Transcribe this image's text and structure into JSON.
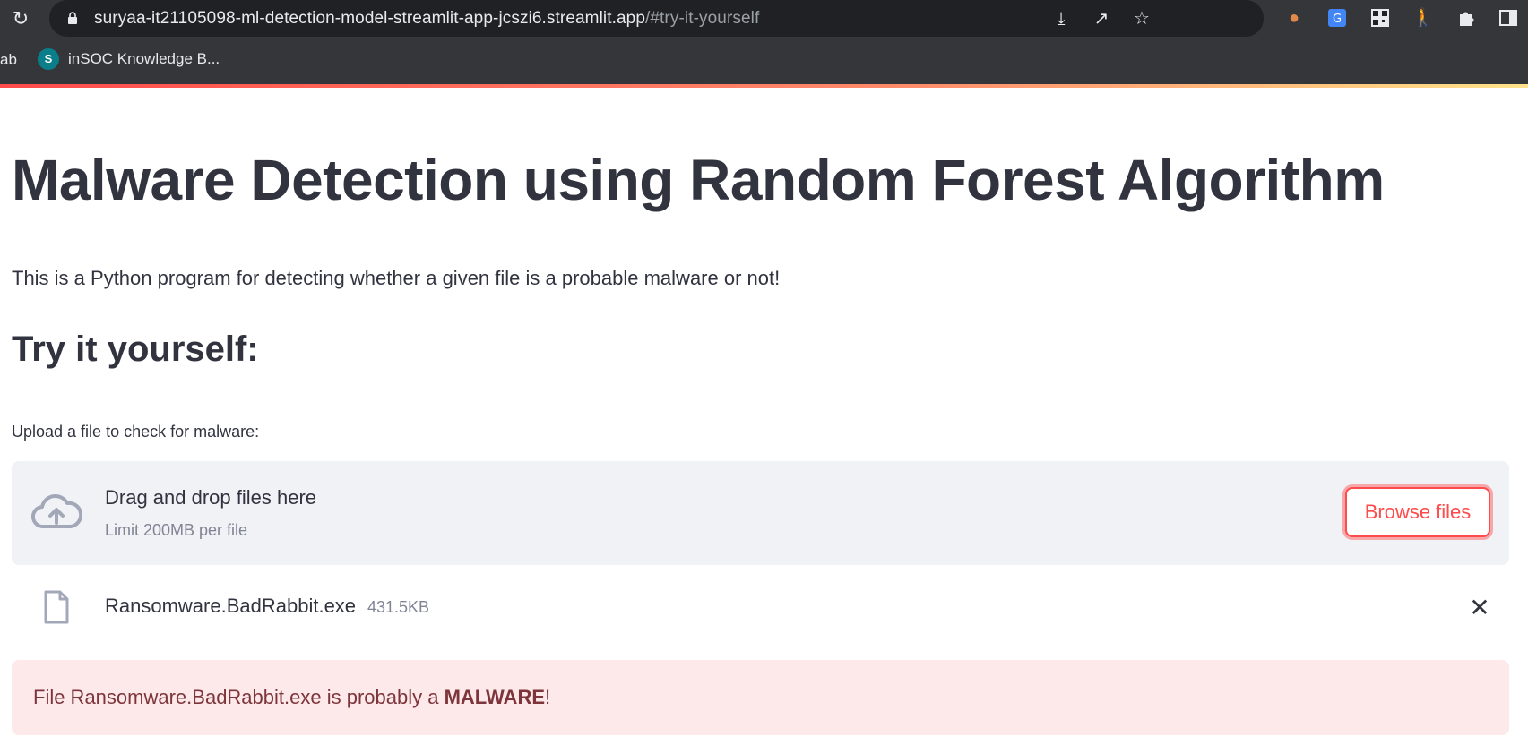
{
  "browser": {
    "url_main": "suryaa-it21105098-ml-detection-model-streamlit-app-jcszi6.streamlit.app",
    "url_hash": "/#try-it-yourself",
    "bookmarks": {
      "partial_left": "ab",
      "item_favicon": "S",
      "item_label": "inSOC Knowledge B..."
    },
    "icons": [
      "reload-icon",
      "lock-icon",
      "install-icon",
      "share-icon",
      "star-icon",
      "cookie-extension-icon",
      "translate-extension-icon",
      "qr-extension-icon",
      "person-extension-icon",
      "puzzle-icon",
      "side-panel-icon"
    ]
  },
  "app": {
    "title": "Malware Detection using Random Forest Algorithm",
    "description": "This is a Python program for detecting whether a given file is a probable malware or not!",
    "subheading": "Try it yourself:",
    "uploader": {
      "label": "Upload a file to check for malware:",
      "dropzone_title": "Drag and drop files here",
      "dropzone_limit": "Limit 200MB per file",
      "browse_label": "Browse files"
    },
    "file": {
      "name": "Ransomware.BadRabbit.exe",
      "size": "431.5KB"
    },
    "result": {
      "prefix": "File Ransomware.BadRabbit.exe is probably a ",
      "verdict": "MALWARE",
      "suffix": "!"
    }
  },
  "colors": {
    "accent": "#ff4b4b",
    "text": "#31333f",
    "muted": "#808495",
    "dropzone_bg": "#f0f2f6",
    "alert_bg": "#fde9e9",
    "alert_text": "#7d353b"
  }
}
